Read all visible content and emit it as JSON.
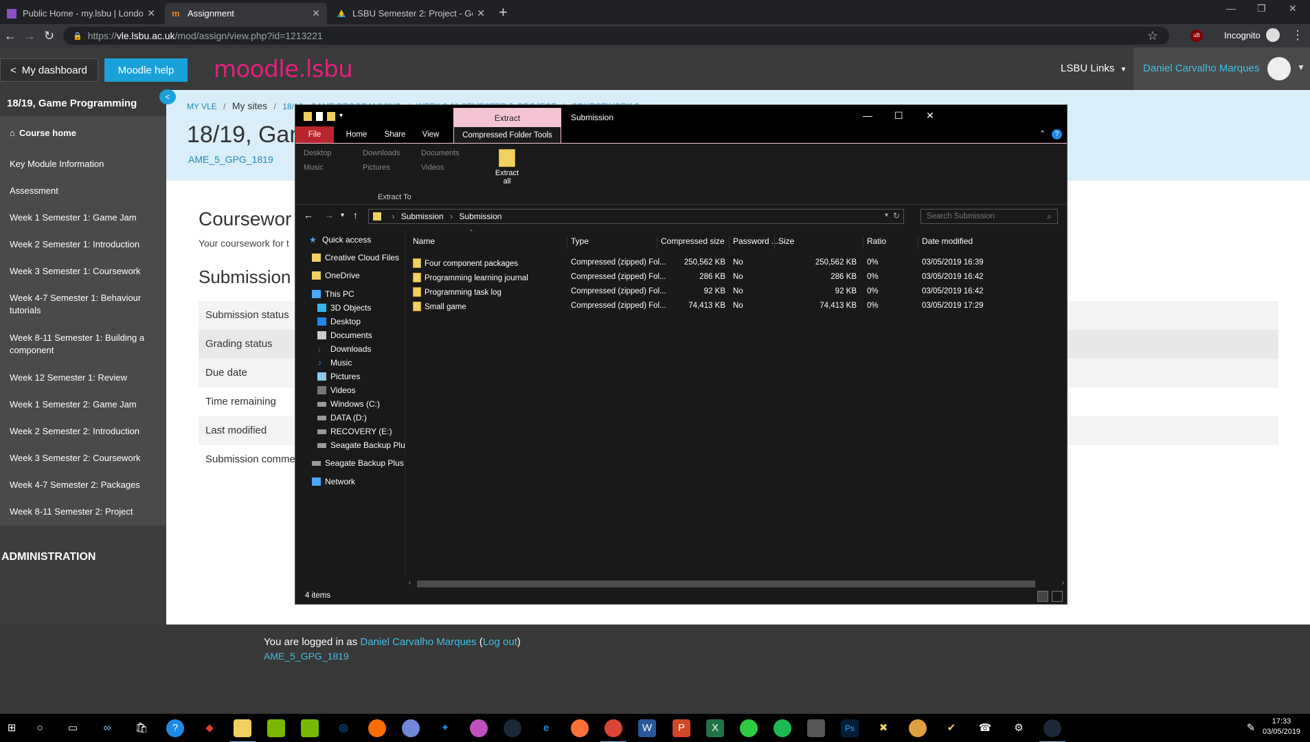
{
  "browser": {
    "tabs": [
      {
        "title": "Public Home - my.lsbu | London",
        "favicon_color": "#8a4fc7"
      },
      {
        "title": "Assignment",
        "favicon_color": "#f98012"
      },
      {
        "title": "LSBU Semester 2: Project - Goog",
        "favicon_color": "#fbbc04"
      }
    ],
    "url_host": "vle.lsbu.ac.uk",
    "url_path": "/mod/assign/view.php?id=1213221",
    "url_scheme": "https://",
    "profile_label": "Incognito"
  },
  "moodle": {
    "dashboard_label": "My dashboard",
    "help_label": "Moodle help",
    "logo_text": "moodle.lsbu",
    "links_label": "LSBU Links",
    "user_name": "Daniel Carvalho Marques",
    "sidebar": {
      "course_title": "18/19, Game Programming",
      "course_home": "Course home",
      "items": [
        "Key Module Information",
        "Assessment",
        "Week 1 Semester 1: Game Jam",
        "Week 2 Semester 1: Introduction",
        "Week 3 Semester 1: Coursework",
        "Week 4-7 Semester 1: Behaviour tutorials",
        "Week 8-11 Semester 1: Building a component",
        "Week 12 Semester 1: Review",
        "Week 1 Semester 2: Game Jam",
        "Week 2 Semester 2: Introduction",
        "Week 3 Semester 2: Coursework",
        "Week 4-7 Semester 2: Packages",
        "Week 8-11 Semester 2: Project"
      ],
      "admin_label": "ADMINISTRATION"
    },
    "breadcrumb": {
      "c1": "MY VLE",
      "c2": "My sites",
      "c3": "18/19 - GAME PROGRAMMING",
      "c4": "WEEK 8-11 SEMESTER 2: PROJECT",
      "c5": "COURSEWORK 2"
    },
    "page_title": "18/19, Gam",
    "shortname": "AME_5_GPG_1819",
    "coursework_title": "Coursewor",
    "coursework_sub": "Your coursework for t",
    "submission_heading": "Submission",
    "status_rows": [
      "Submission status",
      "Grading status",
      "Due date",
      "Time remaining",
      "Last modified",
      "Submission comme"
    ],
    "footer": {
      "logged_in": "You are logged in as ",
      "user": "Daniel Carvalho Marques",
      "logout": "Log out",
      "shortname": "AME_5_GPG_1819"
    }
  },
  "explorer": {
    "title": "Submission",
    "extract_tab": "Extract",
    "ribbon_tabs": [
      "File",
      "Home",
      "Share",
      "View",
      "Compressed Folder Tools"
    ],
    "ribbon_locations": [
      "Desktop",
      "Downloads",
      "Documents",
      "Music",
      "Pictures",
      "Videos"
    ],
    "extract_all": "Extract all",
    "extract_to": "Extract To",
    "path": [
      "Submission",
      "Submission"
    ],
    "search_placeholder": "Search Submission",
    "nav": {
      "quick_access": "Quick access",
      "creative_cloud": "Creative Cloud Files",
      "onedrive": "OneDrive",
      "this_pc": "This PC",
      "pc_items": [
        "3D Objects",
        "Desktop",
        "Documents",
        "Downloads",
        "Music",
        "Pictures",
        "Videos",
        "Windows (C:)",
        "DATA (D:)",
        "RECOVERY (E:)",
        "Seagate Backup Plu"
      ],
      "seagate": "Seagate Backup Plus",
      "network": "Network"
    },
    "columns": [
      "Name",
      "Type",
      "Compressed size",
      "Password ...",
      "Size",
      "Ratio",
      "Date modified"
    ],
    "files": [
      {
        "name": "Four component packages",
        "type": "Compressed (zipped) Fol...",
        "csize": "250,562 KB",
        "pw": "No",
        "size": "250,562 KB",
        "ratio": "0%",
        "date": "03/05/2019 16:39"
      },
      {
        "name": "Programming learning journal",
        "type": "Compressed (zipped) Fol...",
        "csize": "286 KB",
        "pw": "No",
        "size": "286 KB",
        "ratio": "0%",
        "date": "03/05/2019 16:42"
      },
      {
        "name": "Programming task log",
        "type": "Compressed (zipped) Fol...",
        "csize": "92 KB",
        "pw": "No",
        "size": "92 KB",
        "ratio": "0%",
        "date": "03/05/2019 16:42"
      },
      {
        "name": "Small game",
        "type": "Compressed (zipped) Fol...",
        "csize": "74,413 KB",
        "pw": "No",
        "size": "74,413 KB",
        "ratio": "0%",
        "date": "03/05/2019 17:29"
      }
    ],
    "item_count": "4 items"
  },
  "taskbar": {
    "time": "17:33",
    "date": "03/05/2019"
  }
}
